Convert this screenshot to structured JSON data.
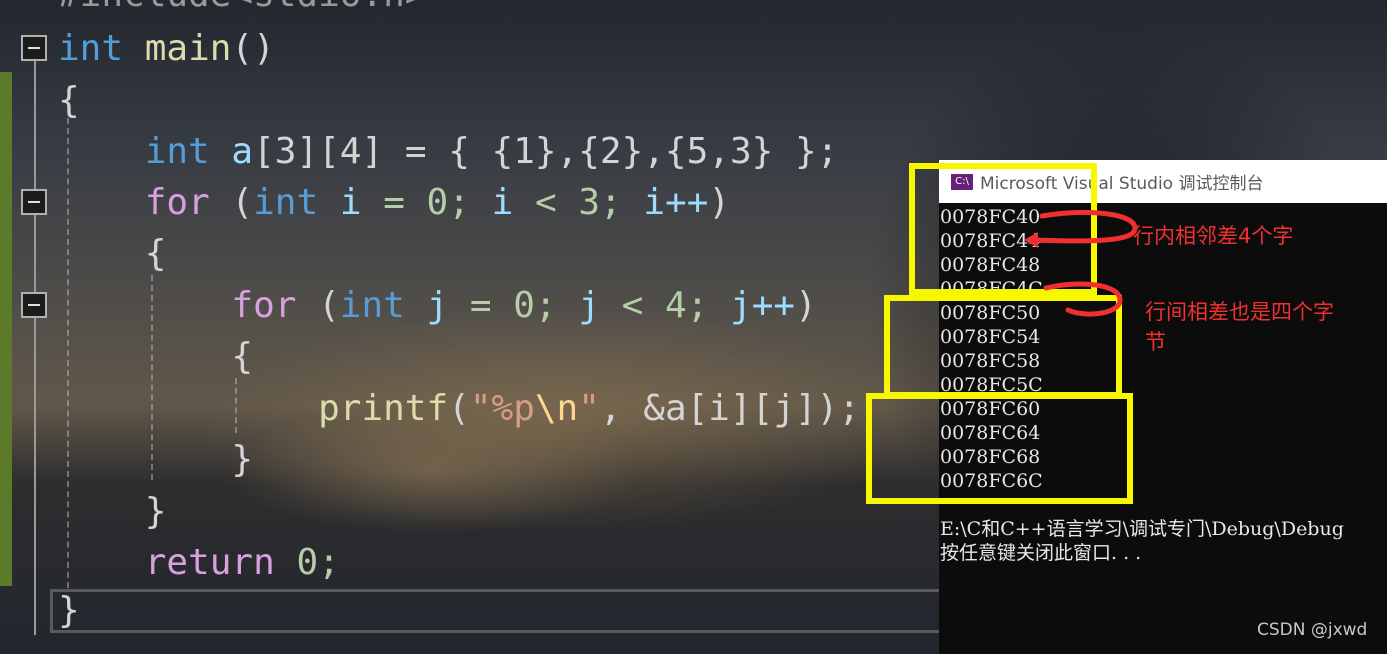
{
  "editor": {
    "top_partial_line": "#include<stdio.h>",
    "code": {
      "int_kw": "int",
      "main_fn": "main",
      "parens": "()",
      "brace_open": "{",
      "brace_close": "}",
      "array_decl": {
        "type": "int",
        "name": "a",
        "dims": "[3][4]",
        "init": "= { {1},{2},{5,3} };"
      },
      "outer_for": {
        "kw": "for",
        "open": "(",
        "type": "int",
        "var": "i",
        "init": "= 0;",
        "cond_var": "i",
        "cond": "< 3;",
        "inc": "i++",
        "close": ")"
      },
      "inner_for": {
        "kw": "for",
        "open": "(",
        "type": "int",
        "var": "j",
        "init": "= 0;",
        "cond_var": "j",
        "cond": "< 4;",
        "inc": "j++",
        "close": ")"
      },
      "printf": {
        "fn": "printf",
        "open": "(",
        "q1": "\"",
        "fmt": "%p",
        "esc": "\\n",
        "q2": "\"",
        "args": ", &a[i][j]);"
      },
      "return_kw": "return",
      "return_val": "0;"
    }
  },
  "console": {
    "title": "Microsoft Visual Studio 调试控制台",
    "icon_label": "C:\\",
    "icon": "vs-console-icon",
    "addresses": [
      "0078FC40",
      "0078FC44",
      "0078FC48",
      "0078FC4C",
      "0078FC50",
      "0078FC54",
      "0078FC58",
      "0078FC5C",
      "0078FC60",
      "0078FC64",
      "0078FC68",
      "0078FC6C"
    ],
    "exit_path": "E:\\C和C++语言学习\\调试专门\\Debug\\Debug",
    "prompt": "按任意键关闭此窗口. . ."
  },
  "annotations": {
    "note_row": "行内相邻差4个字",
    "note_between_line1": "行间相差也是四个字",
    "note_between_line2": "节",
    "color": "#f03030",
    "box_color": "#f7f700"
  },
  "watermark": "CSDN @jxwd"
}
